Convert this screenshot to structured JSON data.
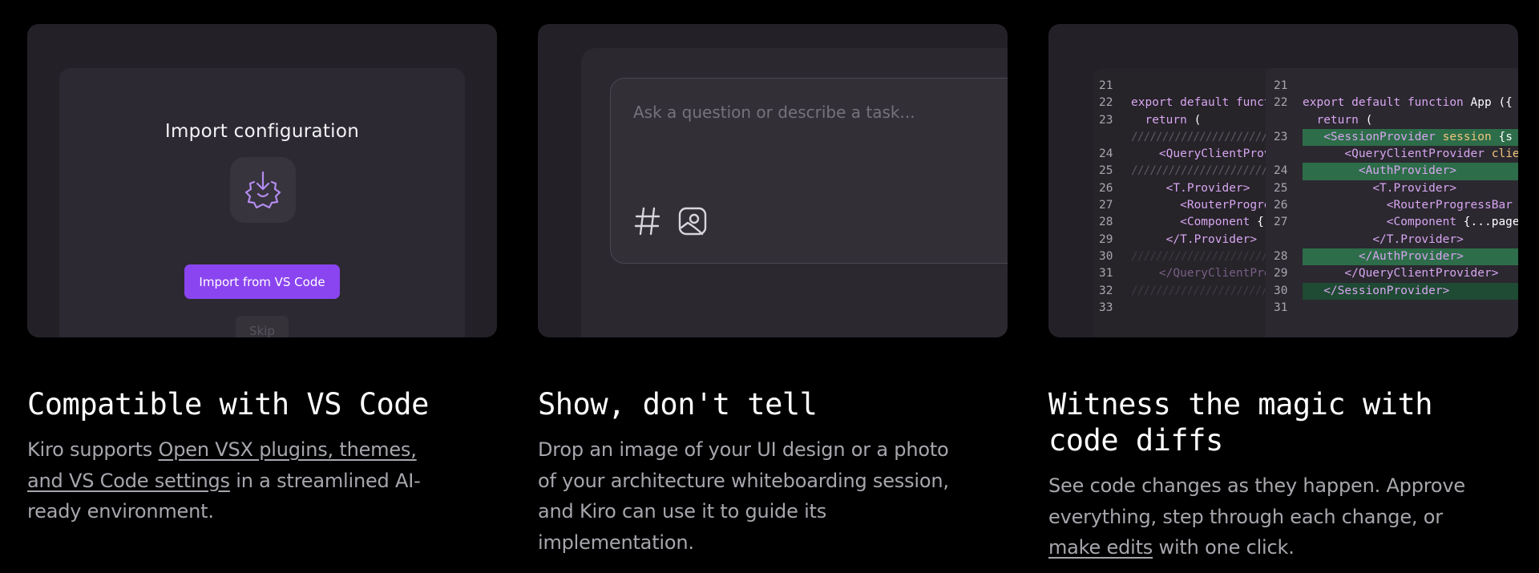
{
  "features": [
    {
      "heading": "Compatible with VS Code",
      "desc_before": "Kiro supports ",
      "desc_link": "Open VSX plugins, themes, and VS Code settings",
      "desc_after": " in a streamlined AI-ready environment.",
      "dialog": {
        "title": "Import configuration",
        "icon": "import-gear-icon",
        "primary_button": "Import from VS Code",
        "secondary_button": "Skip"
      }
    },
    {
      "heading": "Show, don't tell",
      "desc": "Drop an image of your UI design or a photo of your architecture whiteboarding session, and Kiro can use it to guide its implementation.",
      "chat": {
        "placeholder": "Ask a question or describe a task...",
        "icons": [
          "hash-icon",
          "image-icon"
        ]
      }
    },
    {
      "heading_line1": "Witness the magic with",
      "heading_line2": "code diffs",
      "desc_before": "See code changes as they happen. Approve everything, step through each change, or ",
      "desc_link": "make edits",
      "desc_after": " with one click."
    }
  ],
  "diff": {
    "left": [
      {
        "num": "21",
        "text": ""
      },
      {
        "num": "22",
        "text": "export default function App"
      },
      {
        "num": "23",
        "text": "  return ("
      },
      {
        "num": "",
        "text": "///////////////////////"
      },
      {
        "num": "24",
        "text": "    <QueryClientProvider"
      },
      {
        "num": "25",
        "text": "///////////////////////"
      },
      {
        "num": "26",
        "text": "     <T.Provider>"
      },
      {
        "num": "27",
        "text": "       <RouterProgressBar"
      },
      {
        "num": "28",
        "text": "       <Component {..."
      },
      {
        "num": "29",
        "text": "     </T.Provider>"
      },
      {
        "num": "30",
        "text": "///////////////////////"
      },
      {
        "num": "31",
        "text": "    </QueryClientProvider>"
      },
      {
        "num": "32",
        "text": "///////////////////////"
      },
      {
        "num": "33",
        "text": ""
      }
    ],
    "right": [
      {
        "num": "21",
        "text": "",
        "hl": false
      },
      {
        "num": "22",
        "text": "export default function App ({",
        "hl": false
      },
      {
        "num": "",
        "text": "  return (",
        "hl": false
      },
      {
        "num": "23",
        "text": "   <SessionProvider session {s",
        "hl": true
      },
      {
        "num": "",
        "text": "      <QueryClientProvider clien",
        "hl": false
      },
      {
        "num": "24",
        "text": "        <AuthProvider>",
        "hl": true
      },
      {
        "num": "25",
        "text": "          <T.Provider>",
        "hl": false
      },
      {
        "num": "26",
        "text": "            <RouterProgressBar /",
        "hl": false
      },
      {
        "num": "27",
        "text": "            <Component {...pageP",
        "hl": false
      },
      {
        "num": "",
        "text": "          </T.Provider>",
        "hl": false
      },
      {
        "num": "28",
        "text": "        </AuthProvider>",
        "hl": true
      },
      {
        "num": "29",
        "text": "      </QueryClientProvider>",
        "hl": false
      },
      {
        "num": "30",
        "text": "   </SessionProvider>",
        "hl": true
      },
      {
        "num": "31",
        "text": "",
        "hl": false
      }
    ]
  },
  "colors": {
    "accent": "#8a45f0",
    "diff_added": "#2d6d49"
  }
}
